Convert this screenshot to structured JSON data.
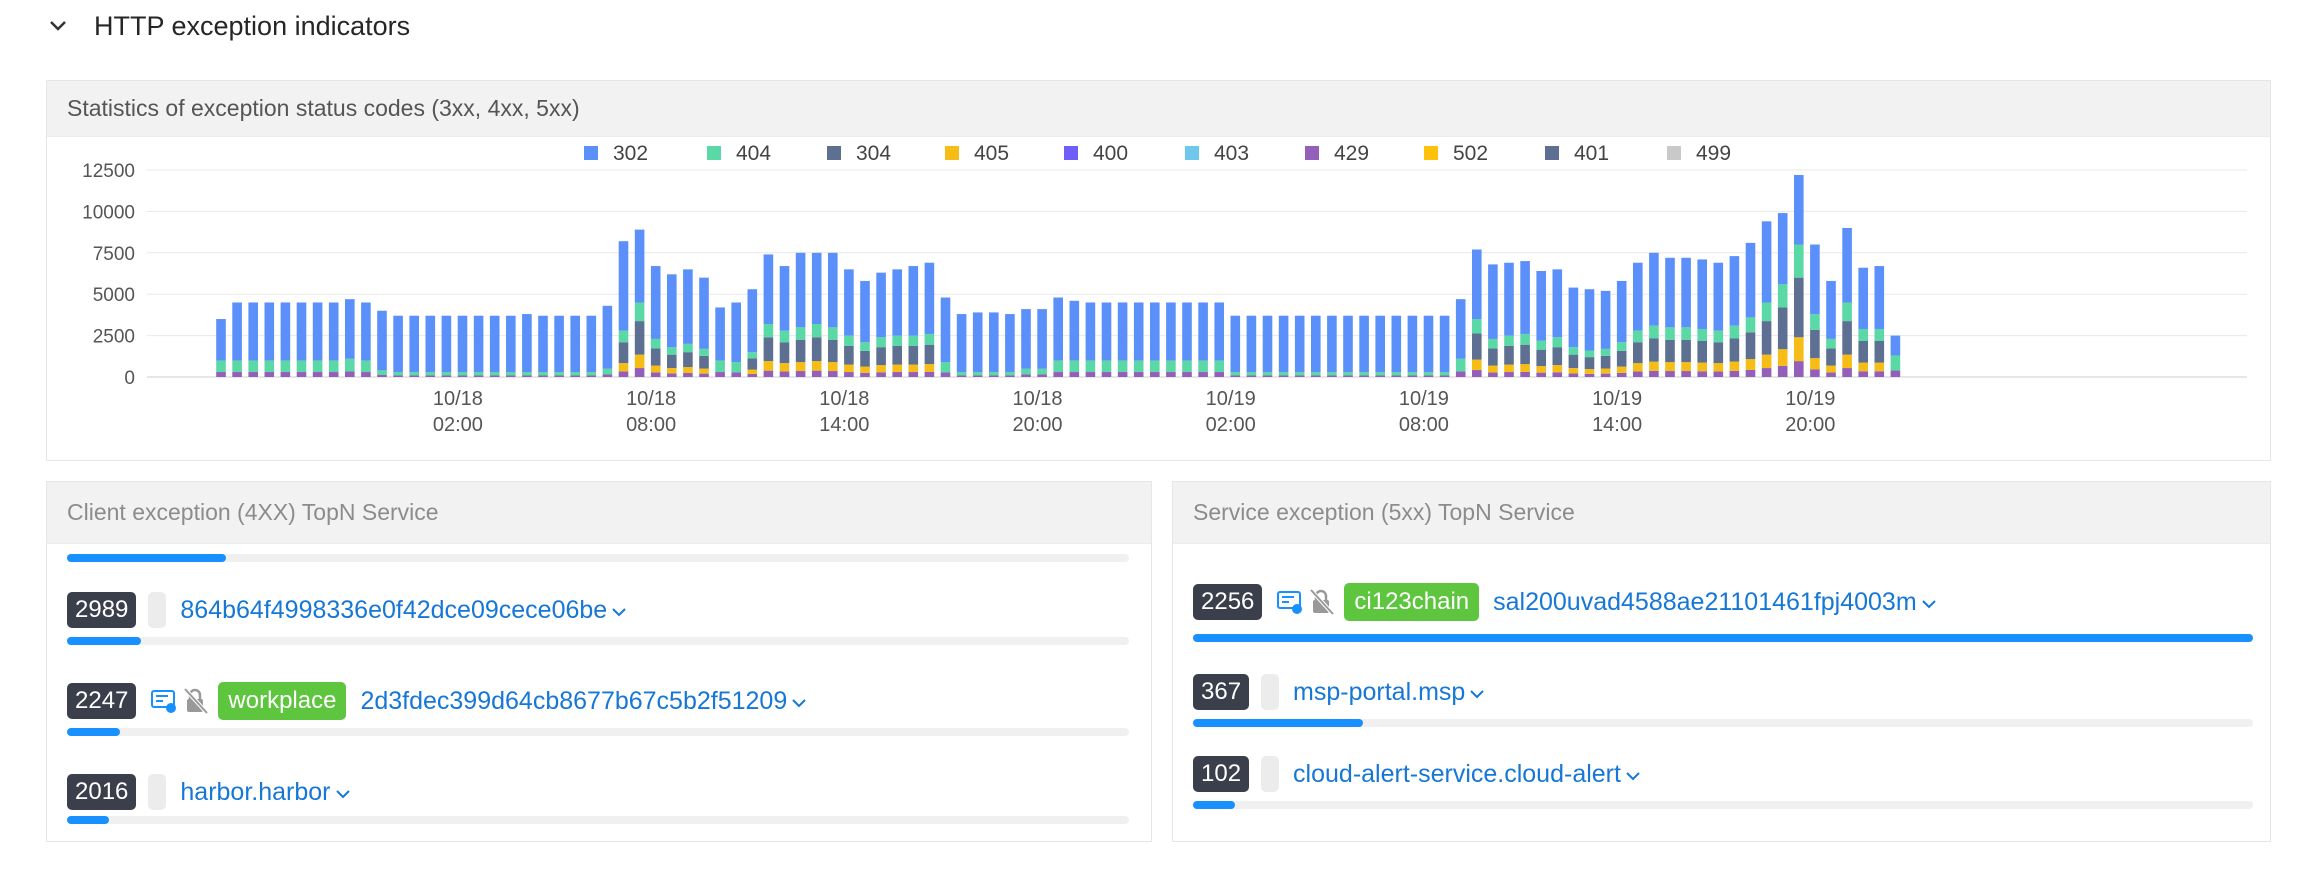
{
  "section": {
    "title": "HTTP exception indicators"
  },
  "stats_panel": {
    "title": "Statistics of exception status codes (3xx, 4xx, 5xx)"
  },
  "colors": {
    "link": "#1677d6",
    "bar": "#1890ff",
    "badge": "#3a3f4b",
    "green_tag": "#5ec53f"
  },
  "chart_data": {
    "type": "bar",
    "stacked": true,
    "legend_position": "top",
    "grid": true,
    "ylim": [
      0,
      12500
    ],
    "yticks": [
      "0",
      "2500",
      "5000",
      "7500",
      "10000",
      "12500"
    ],
    "xtick_labels": [
      {
        "date": "10/18",
        "time": "02:00",
        "index": 9
      },
      {
        "date": "10/18",
        "time": "08:00",
        "index": 21
      },
      {
        "date": "10/18",
        "time": "14:00",
        "index": 33
      },
      {
        "date": "10/18",
        "time": "20:00",
        "index": 45
      },
      {
        "date": "10/19",
        "time": "02:00",
        "index": 57
      },
      {
        "date": "10/19",
        "time": "08:00",
        "index": 69
      },
      {
        "date": "10/19",
        "time": "14:00",
        "index": 81
      },
      {
        "date": "10/19",
        "time": "20:00",
        "index": 93
      }
    ],
    "series_meta": [
      {
        "name": "302",
        "color": "#5b8ff9"
      },
      {
        "name": "404",
        "color": "#5ad8a6"
      },
      {
        "name": "304",
        "color": "#5d7092"
      },
      {
        "name": "405",
        "color": "#f6bd16"
      },
      {
        "name": "400",
        "color": "#6f5ef9"
      },
      {
        "name": "403",
        "color": "#6dc8ec"
      },
      {
        "name": "429",
        "color": "#945fb9"
      },
      {
        "name": "502",
        "color": "#ffc10a"
      },
      {
        "name": "401",
        "color": "#5d7092"
      },
      {
        "name": "499",
        "color": "#c9c9c9"
      }
    ],
    "totals": [
      3500,
      4500,
      4500,
      4500,
      4500,
      4500,
      4500,
      4500,
      4700,
      4500,
      4000,
      3700,
      3700,
      3700,
      3700,
      3700,
      3700,
      3700,
      3700,
      3800,
      3700,
      3700,
      3700,
      3700,
      4300,
      8200,
      8900,
      6700,
      6200,
      6500,
      6000,
      4200,
      4500,
      5300,
      7400,
      6700,
      7500,
      7500,
      7500,
      6500,
      5800,
      6300,
      6500,
      6700,
      6900,
      4800,
      3800,
      3900,
      3900,
      3800,
      4100,
      4100,
      4800,
      4600,
      4500,
      4500,
      4500,
      4500,
      4500,
      4500,
      4500,
      4500,
      4500,
      3700,
      3700,
      3700,
      3700,
      3700,
      3700,
      3700,
      3700,
      3700,
      3700,
      3700,
      3700,
      3700,
      3700,
      4700,
      7700,
      6800,
      6900,
      7000,
      6400,
      6500,
      5400,
      5300,
      5200,
      5800,
      6900,
      7500,
      7200,
      7200,
      7100,
      6900,
      7300,
      8100,
      9400,
      9900,
      12200,
      8000,
      5800,
      9000,
      6600,
      6700,
      2500
    ],
    "secondary": [
      1000,
      1000,
      1000,
      1000,
      1000,
      1000,
      1000,
      1000,
      1100,
      1000,
      400,
      300,
      300,
      300,
      300,
      300,
      300,
      300,
      300,
      300,
      300,
      300,
      300,
      300,
      500,
      2800,
      4500,
      2300,
      1800,
      2000,
      1700,
      1000,
      900,
      1500,
      3200,
      2800,
      3000,
      3200,
      3000,
      2500,
      2100,
      2400,
      2500,
      2500,
      2600,
      900,
      300,
      300,
      300,
      300,
      500,
      500,
      1000,
      1000,
      1000,
      1000,
      1000,
      1000,
      1000,
      1000,
      1000,
      1000,
      1000,
      300,
      300,
      300,
      300,
      300,
      300,
      300,
      300,
      300,
      300,
      300,
      300,
      300,
      300,
      1100,
      3500,
      2300,
      2500,
      2600,
      2200,
      2400,
      1800,
      1600,
      1700,
      2100,
      2800,
      3100,
      3000,
      3000,
      2900,
      2800,
      3100,
      3600,
      4500,
      5600,
      8000,
      3800,
      2300,
      4500,
      2900,
      2900,
      1300
    ]
  },
  "client_panel": {
    "title": "Client exception (4XX) TopN Service",
    "top_bar_fraction": 0.15,
    "rows": [
      {
        "count": "2989",
        "service": "864b64f4998336e0f42dce09cece06be",
        "tag": "",
        "icons": false,
        "fraction": 0.07
      },
      {
        "count": "2247",
        "service": "2d3fdec399d64cb8677b67c5b2f51209",
        "tag": "workplace",
        "icons": true,
        "fraction": 0.05
      },
      {
        "count": "2016",
        "service": "harbor.harbor",
        "tag": "",
        "icons": false,
        "fraction": 0.04
      }
    ]
  },
  "service_panel": {
    "title": "Service exception (5xx) TopN Service",
    "rows": [
      {
        "count": "2256",
        "service": "sal200uvad4588ae21101461fpj4003m",
        "tag": "ci123chain",
        "icons": true,
        "fraction": 1.0
      },
      {
        "count": "367",
        "service": "msp-portal.msp",
        "tag": "",
        "icons": false,
        "fraction": 0.16
      },
      {
        "count": "102",
        "service": "cloud-alert-service.cloud-alert",
        "tag": "",
        "icons": false,
        "fraction": 0.04
      }
    ]
  }
}
